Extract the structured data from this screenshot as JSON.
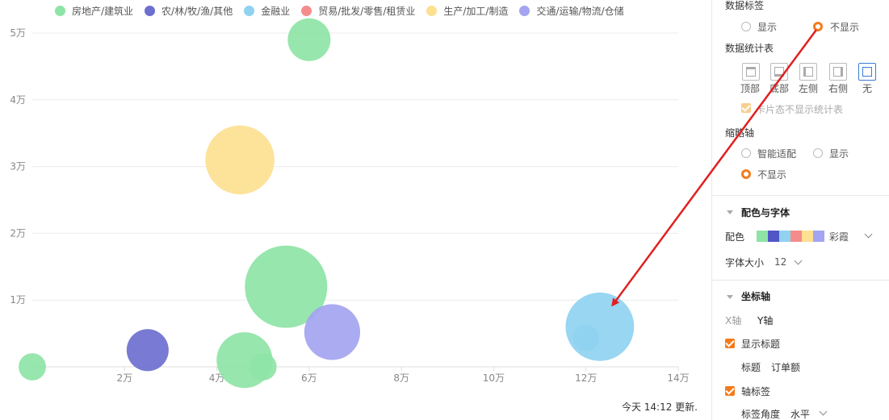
{
  "chart_data": {
    "type": "scatter",
    "subtype": "bubble",
    "legend": [
      {
        "name": "房地产/建筑业",
        "color": "#8ee4a6"
      },
      {
        "name": "农/林/牧/渔/其他",
        "color": "#6d6fcf"
      },
      {
        "name": "金融业",
        "color": "#8fd3f1"
      },
      {
        "name": "贸易/批发/零售/租赁业",
        "color": "#f58c8c"
      },
      {
        "name": "生产/加工/制造",
        "color": "#fde090"
      },
      {
        "name": "交通/运输/物流/仓储",
        "color": "#a4a4f1"
      }
    ],
    "x_ticks": [
      "2万",
      "4万",
      "6万",
      "8万",
      "10万",
      "12万",
      "14万"
    ],
    "y_ticks": [
      "1万",
      "2万",
      "3万",
      "4万",
      "5万"
    ],
    "xlim": [
      0,
      140000
    ],
    "ylim": [
      0,
      50000
    ],
    "points": [
      {
        "series": 0,
        "x": 0,
        "y": 0,
        "size": 1.1
      },
      {
        "series": 1,
        "x": 25000,
        "y": 2500,
        "size": 2.6
      },
      {
        "series": 0,
        "x": 46000,
        "y": 1000,
        "size": 4.6
      },
      {
        "series": 0,
        "x": 50000,
        "y": 0,
        "size": 1.1
      },
      {
        "series": 0,
        "x": 55000,
        "y": 12000,
        "size": 10
      },
      {
        "series": 5,
        "x": 65000,
        "y": 5200,
        "size": 4.6
      },
      {
        "series": 4,
        "x": 45000,
        "y": 31000,
        "size": 7
      },
      {
        "series": 0,
        "x": 60000,
        "y": 49000,
        "size": 2.7
      },
      {
        "series": 2,
        "x": 123000,
        "y": 6000,
        "size": 6.9
      },
      {
        "series": 2,
        "x": 120000,
        "y": 4300,
        "size": 1.0
      }
    ],
    "grid": true,
    "legend_position": "top"
  },
  "status": {
    "update_text": "今天 14:12 更新."
  },
  "panel": {
    "data_label": {
      "title": "数据标签",
      "options": [
        "显示",
        "不显示"
      ],
      "selected": "不显示"
    },
    "stat_table": {
      "title": "数据统计表",
      "positions": [
        "顶部",
        "底部",
        "左侧",
        "右侧",
        "无"
      ],
      "selected": "无",
      "card_hide_label": "卡片态不显示统计表"
    },
    "zoom_axis": {
      "title": "缩略轴",
      "options": [
        "智能适配",
        "显示",
        "不显示"
      ],
      "selected": "不显示"
    },
    "color_font": {
      "title": "配色与字体",
      "color_label": "配色",
      "palette_name": "彩霞",
      "palette": [
        "#8ee4a6",
        "#5056c6",
        "#8fd3f1",
        "#f58c8c",
        "#fde090",
        "#a4a4f1"
      ],
      "font_size_label": "字体大小",
      "font_size_value": "12"
    },
    "axis": {
      "title": "坐标轴",
      "tabs": [
        "X轴",
        "Y轴"
      ],
      "show_title_label": "显示标题",
      "title_field_label": "标题",
      "title_field_value": "订单额",
      "axis_label_label": "轴标签",
      "label_angle_label": "标签角度",
      "label_angle_value": "水平"
    }
  }
}
